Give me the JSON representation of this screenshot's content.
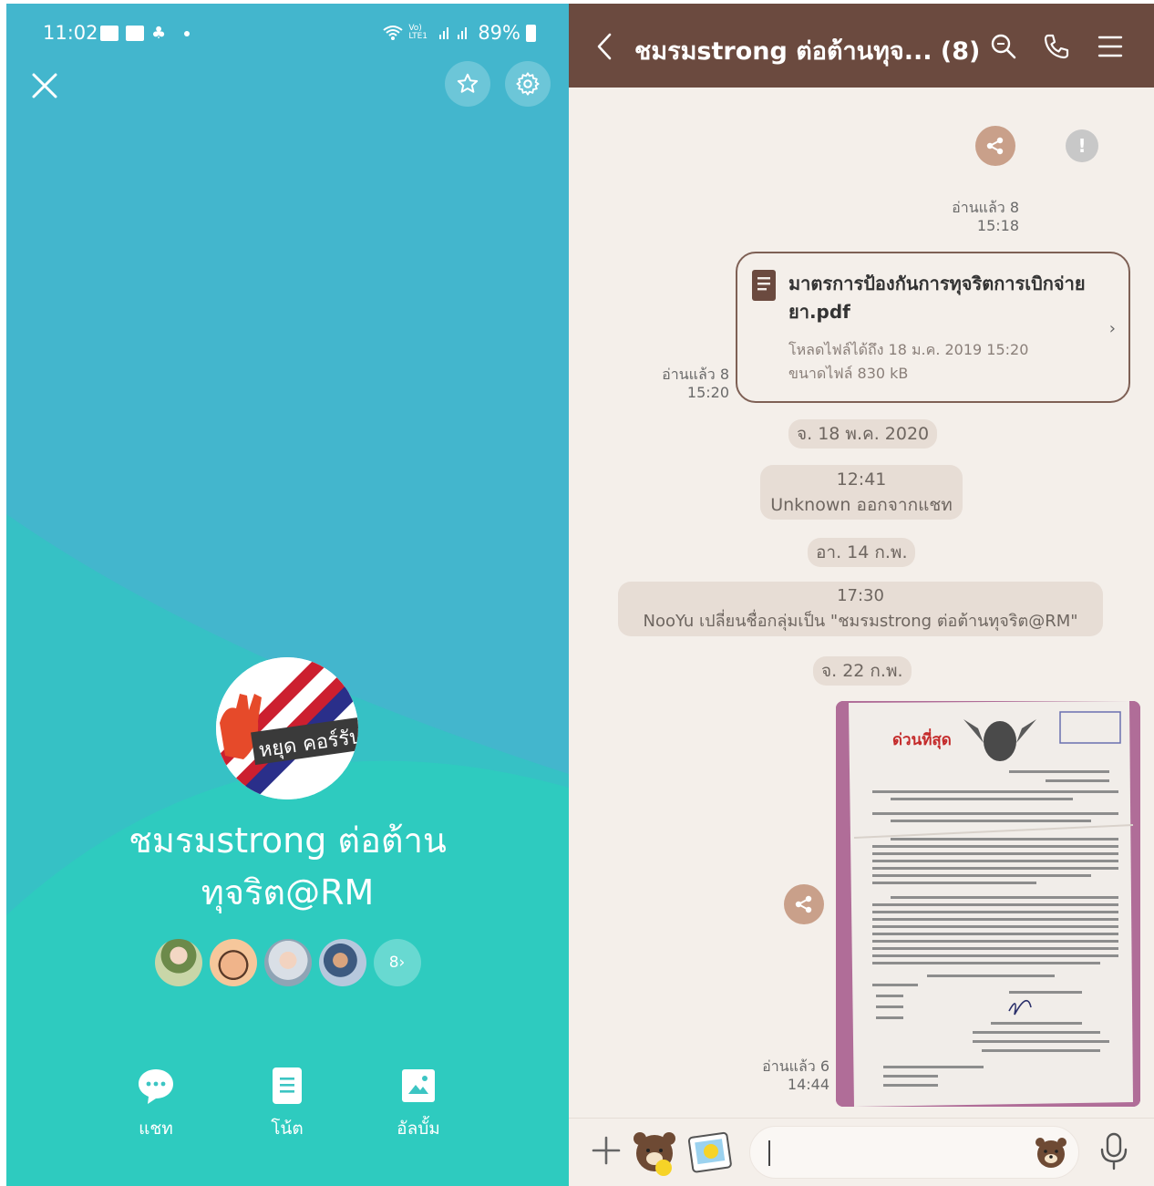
{
  "status_bar": {
    "time": "11:02",
    "signal_text": "Vo) LTE1",
    "battery": "89%"
  },
  "profile": {
    "group_name_line1": "ชมรมstrong ต่อต้าน",
    "group_name_line2": "ทุจริต@RM",
    "avatar_text": "หยุด คอร์รัปชั่น!!",
    "more_members": "8›",
    "actions": [
      {
        "label": "แชท",
        "icon": "chat-bubble-icon"
      },
      {
        "label": "โน้ต",
        "icon": "note-icon"
      },
      {
        "label": "อัลบั้ม",
        "icon": "album-icon"
      }
    ]
  },
  "chat": {
    "title": "ชมรมstrong ต่อต้านทุจ... (8)",
    "messages": {
      "read1": "อ่านแล้ว 8",
      "time1": "15:18",
      "file_name": "มาตรการป้องกันการทุจริตการเบิกจ่ายยา.pdf",
      "file_deadline": "โหลดไฟล์ได้ถึง 18 ม.ค. 2019 15:20",
      "file_size": "ขนาดไฟล์ 830 kB",
      "read2": "อ่านแล้ว 8",
      "time2": "15:20",
      "date1": "จ. 18 พ.ค. 2020",
      "sys1_time": "12:41",
      "sys1_text": "Unknown ออกจากแชท",
      "date2": "อา. 14 ก.พ.",
      "sys2_time": "17:30",
      "sys2_text": "NooYu เปลี่ยนชื่อกลุ่มเป็น \"ชมรมstrong ต่อต้านทุจริต@RM\"",
      "date3": "จ. 22 ก.พ.",
      "read3": "อ่านแล้ว 6",
      "time3": "14:44",
      "doc_heading": "ด่วนที่สุด"
    },
    "input_placeholder": ""
  },
  "colors": {
    "left_bg_top": "#43b6cd",
    "left_bg_bottom": "#2ecbbf",
    "header_brown": "#6b4a3f",
    "chat_bg": "#f4efea",
    "pill_bg": "#e7ddd5"
  }
}
